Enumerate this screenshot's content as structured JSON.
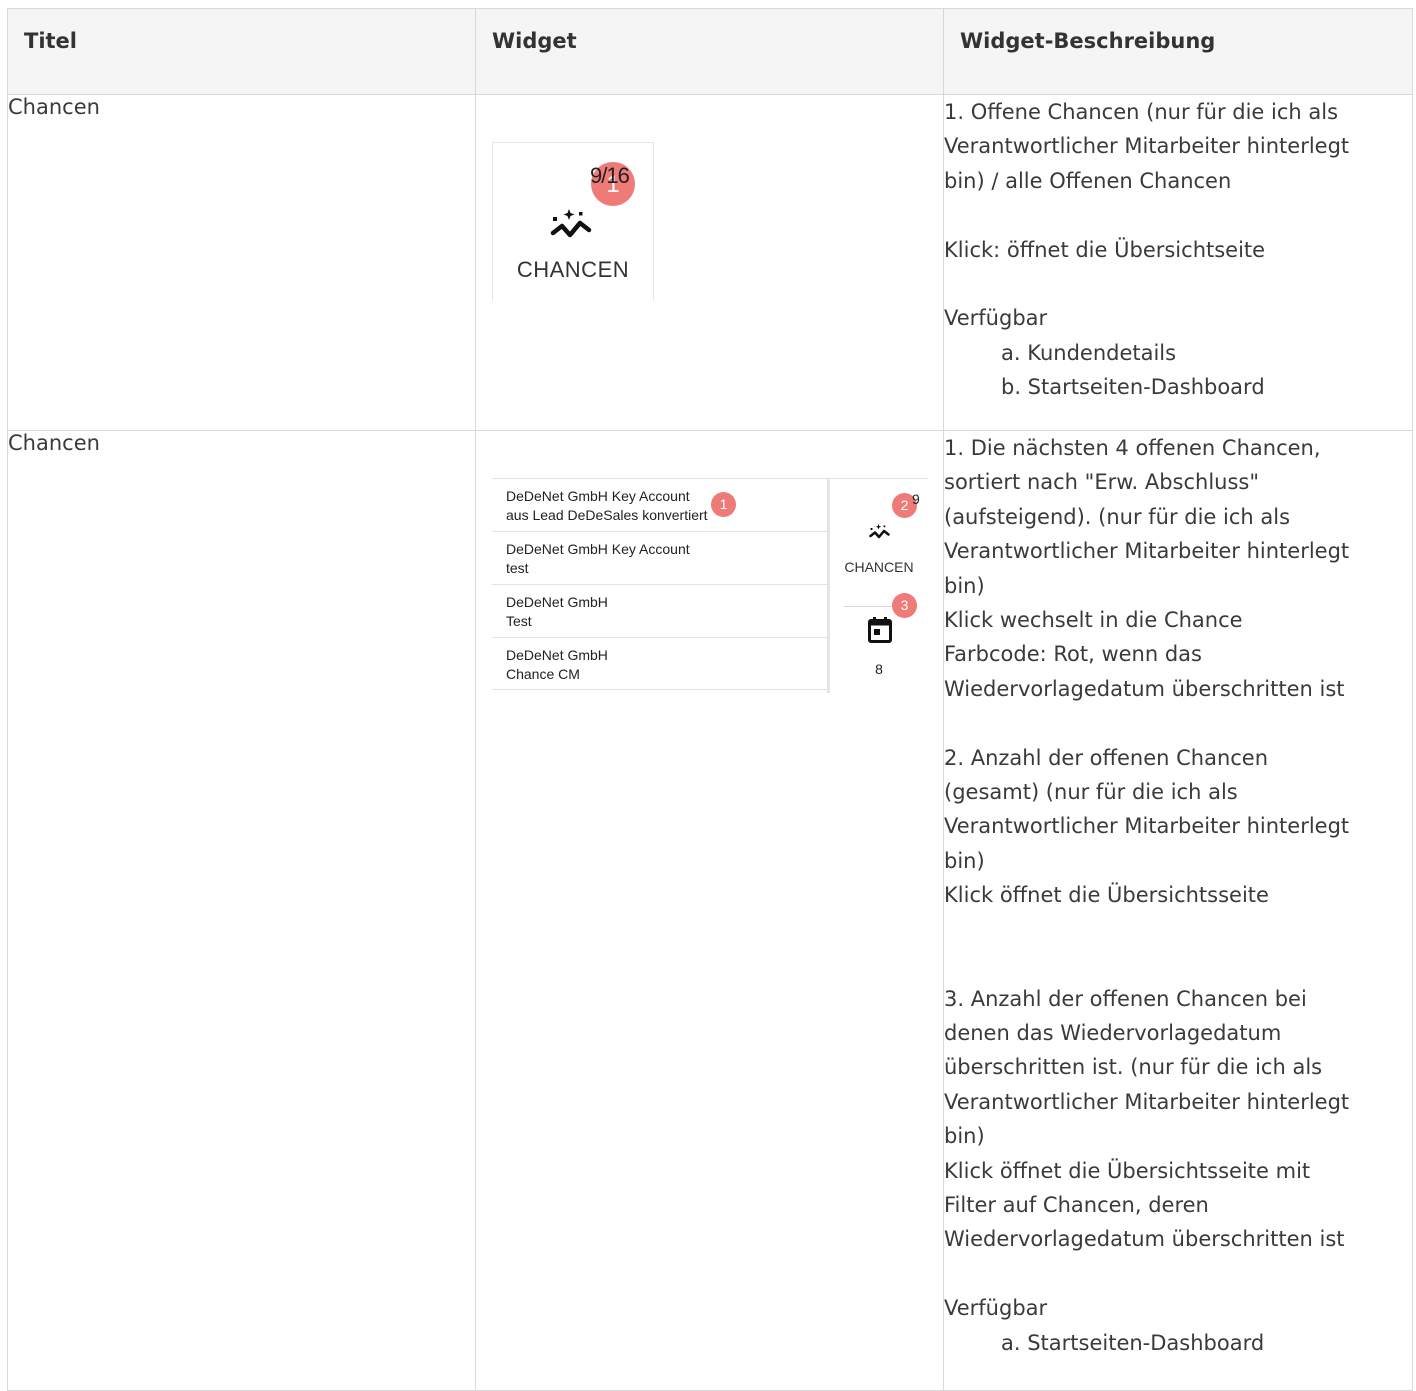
{
  "table": {
    "headers": [
      "Titel",
      "Widget",
      "Widget-Beschreibung"
    ],
    "rows": [
      {
        "title": "Chancen",
        "widget": {
          "count": "9/16",
          "badge": "1",
          "label": "CHANCEN"
        },
        "desc": [
          "1. Offene Chancen (nur für die ich als",
          "Verantwortlicher Mitarbeiter hinterlegt",
          "bin) / alle Offenen Chancen",
          "",
          "Klick: öffnet die Übersichtseite",
          "",
          "Verfügbar"
        ],
        "desc_sub": [
          "a. Kundendetails",
          "b. Startseiten-Dashboard"
        ]
      },
      {
        "title": "Chancen",
        "widget": {
          "list": [
            {
              "line1": "DeDeNet GmbH Key Account",
              "line2": "aus Lead DeDeSales konvertiert"
            },
            {
              "line1": "DeDeNet GmbH Key Account",
              "line2": "test"
            },
            {
              "line1": "DeDeNet GmbH",
              "line2": "Test"
            },
            {
              "line1": "DeDeNet GmbH",
              "line2": "Chance CM"
            }
          ],
          "badge1": "1",
          "badge2": "2",
          "badge3": "3",
          "count": "9",
          "label": "CHANCEN",
          "calendar_count": "8"
        },
        "desc": [
          "1. Die nächsten 4 offenen Chancen,",
          "sortiert nach \"Erw. Abschluss\"",
          "(aufsteigend). (nur für die ich als",
          "Verantwortlicher Mitarbeiter hinterlegt",
          "bin)",
          "Klick wechselt in die Chance",
          "Farbcode: Rot, wenn das",
          "Wiedervorlagedatum überschritten ist",
          "",
          "2. Anzahl der offenen Chancen",
          "(gesamt) (nur für die ich als",
          "Verantwortlicher Mitarbeiter hinterlegt",
          "bin)",
          "Klick öffnet die Übersichtsseite",
          "",
          "",
          "3. Anzahl der offenen Chancen bei",
          "denen das Wiedervorlagedatum",
          "überschritten ist. (nur für die ich als",
          "Verantwortlicher Mitarbeiter hinterlegt",
          "bin)",
          "Klick öffnet die Übersichtsseite mit",
          "Filter auf Chancen, deren",
          "Wiedervorlagedatum überschritten ist",
          "",
          "Verfügbar"
        ],
        "desc_sub": [
          "a. Startseiten-Dashboard"
        ]
      }
    ]
  },
  "icons": {
    "chart": "sparkle-trend-icon",
    "calendar": "calendar-event-icon"
  },
  "colors": {
    "badge": "#ee7b78",
    "border": "#d8d8d8",
    "header_bg": "#f5f5f5",
    "text": "#3a3a3a"
  }
}
